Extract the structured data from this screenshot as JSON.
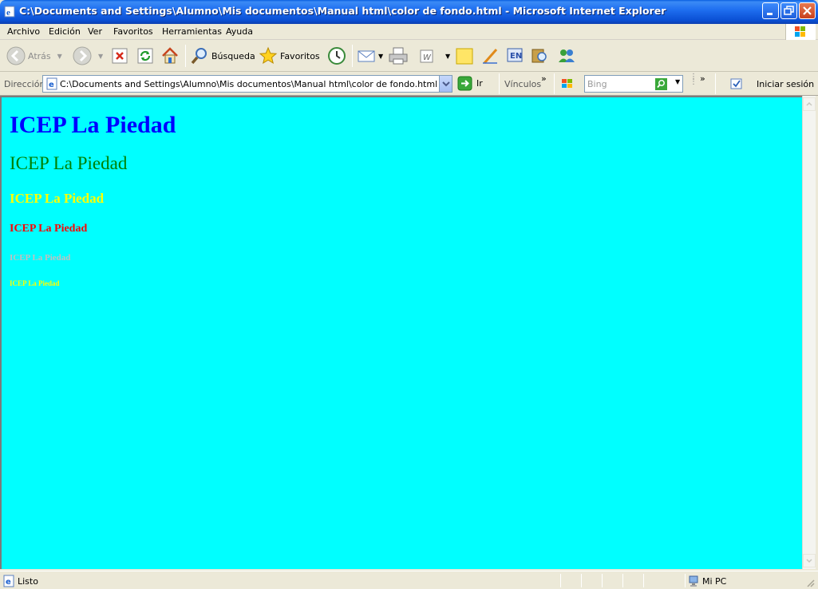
{
  "window": {
    "title": "C:\\Documents and Settings\\Alumno\\Mis documentos\\Manual html\\color de fondo.html - Microsoft Internet Explorer"
  },
  "menu": [
    "Archivo",
    "Edición",
    "Ver",
    "Favoritos",
    "Herramientas",
    "Ayuda"
  ],
  "toolbar": {
    "back_label": "Atrás",
    "search_label": "Búsqueda",
    "favorites_label": "Favoritos"
  },
  "address": {
    "label": "Dirección",
    "url": "C:\\Documents and Settings\\Alumno\\Mis documentos\\Manual html\\color de fondo.html",
    "go_label": "Ir",
    "links_label": "Vínculos",
    "search_placeholder": "Bing",
    "signin_label": "Iniciar sesión"
  },
  "page": {
    "background_color": "#00ffff",
    "headings": [
      {
        "level": 1,
        "text": "ICEP La Piedad",
        "color": "#0000ff"
      },
      {
        "level": 2,
        "text": "ICEP La Piedad",
        "color": "#008000"
      },
      {
        "level": 3,
        "text": "ICEP La Piedad",
        "color": "#ffff00"
      },
      {
        "level": 4,
        "text": "ICEP La Piedad",
        "color": "#ff0000"
      },
      {
        "level": 5,
        "text": "ICEP La Piedad",
        "color": "#c0c0c0"
      },
      {
        "level": 6,
        "text": "ICEP La Piedad",
        "color": "#ffff00"
      }
    ]
  },
  "status": {
    "text": "Listo",
    "zone": "Mi PC"
  },
  "icons": [
    "ie-icon",
    "minimize-icon",
    "maximize-icon",
    "close-icon",
    "back-arrow-icon",
    "forward-arrow-icon",
    "stop-icon",
    "refresh-icon",
    "home-icon",
    "search-magnifier-icon",
    "favorites-star-icon",
    "history-icon",
    "mail-icon",
    "print-icon",
    "edit-icon",
    "note-icon",
    "pen-icon",
    "messenger-icon",
    "research-icon",
    "page-icon",
    "go-arrow-icon",
    "windows-flag-icon",
    "search-icon",
    "checkbox-icon",
    "computer-icon"
  ]
}
